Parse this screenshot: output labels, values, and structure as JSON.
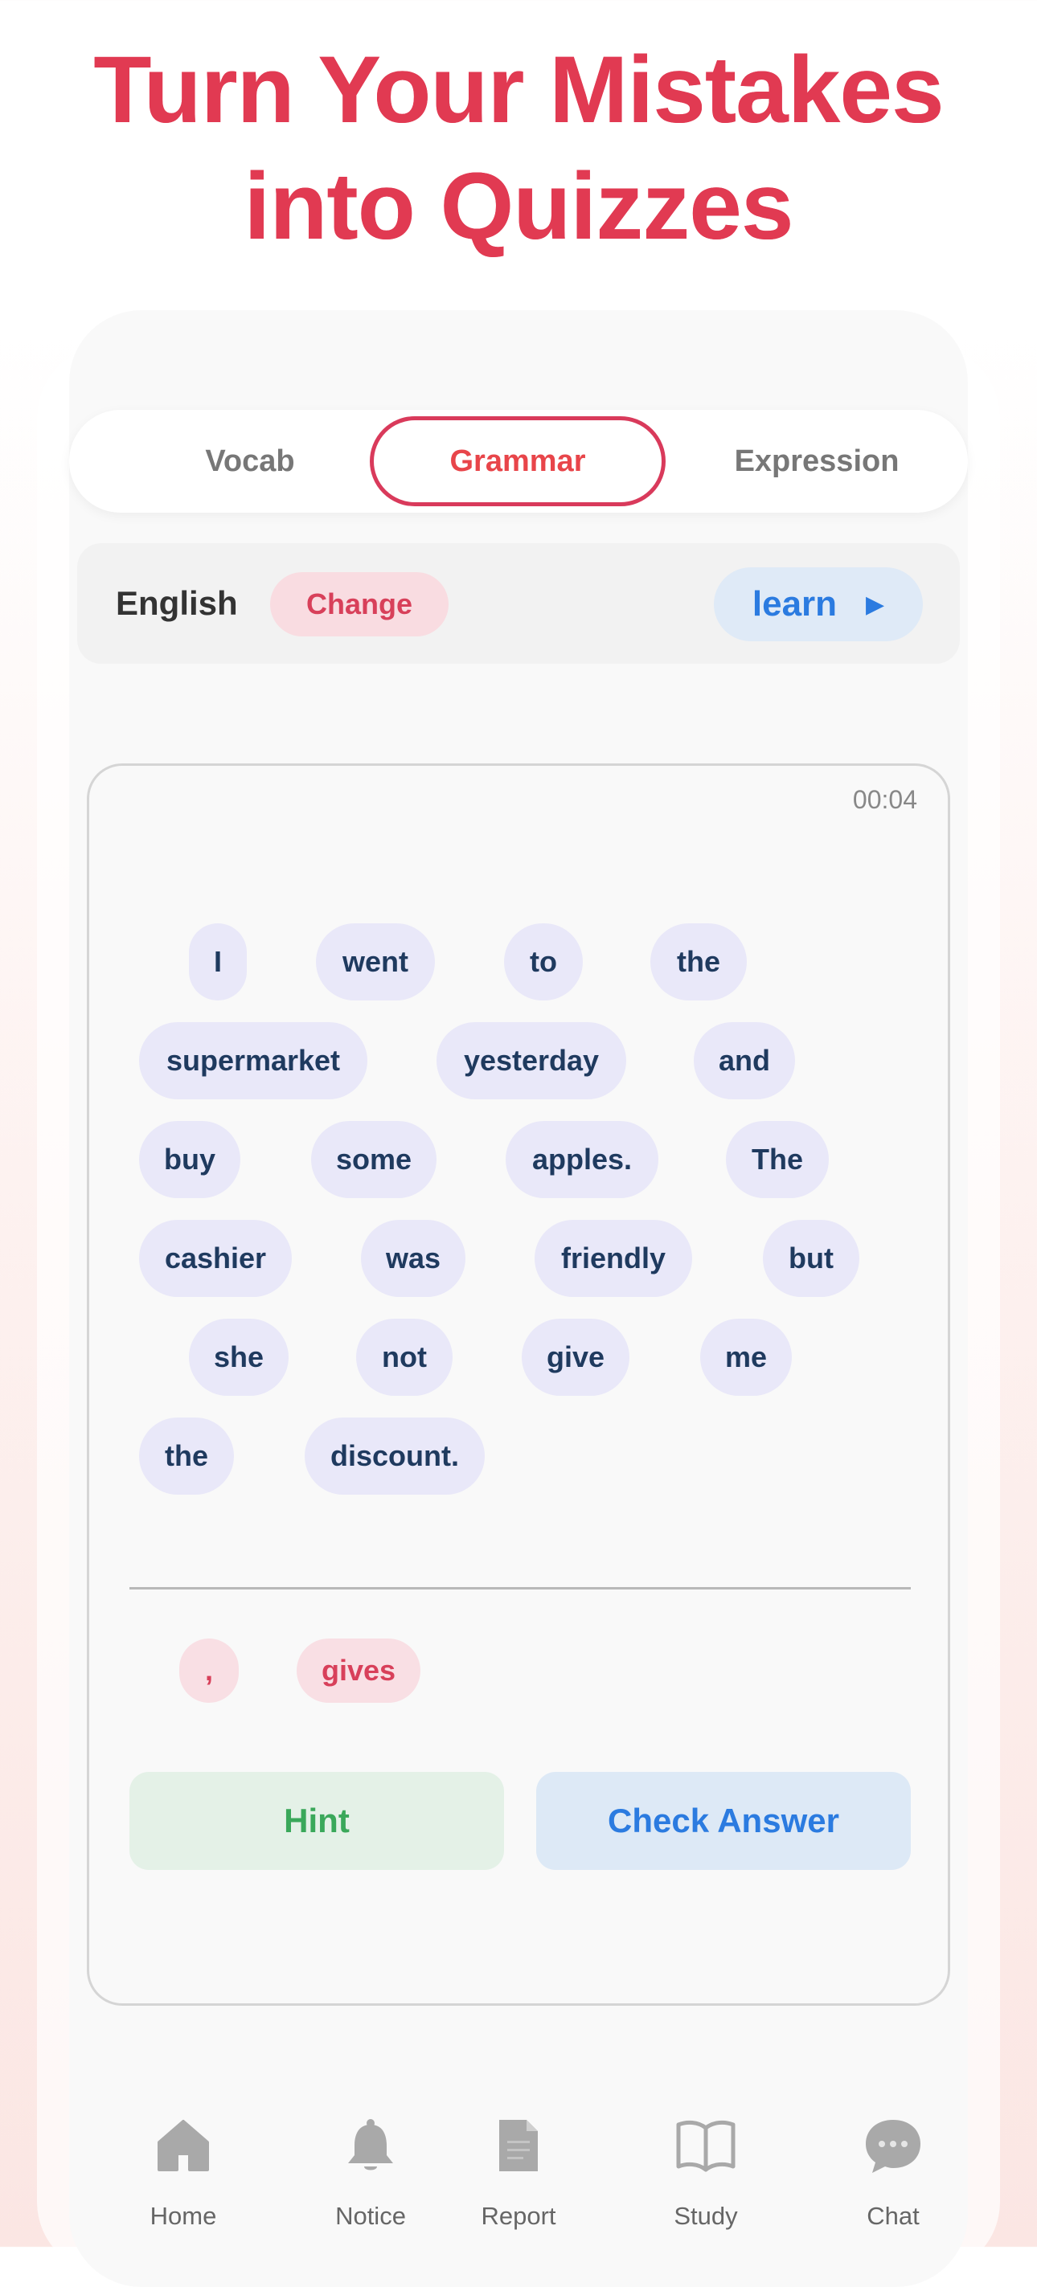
{
  "headline": {
    "line1": "Turn Your Mistakes",
    "line2": "into Quizzes"
  },
  "tabs": [
    {
      "label": "Vocab",
      "active": false
    },
    {
      "label": "Grammar",
      "active": true
    },
    {
      "label": "Expression",
      "active": false
    }
  ],
  "language_bar": {
    "language": "English",
    "change_label": "Change",
    "learn_label": "learn",
    "learn_icon": "play-triangle-icon"
  },
  "quiz": {
    "timer": "00:04",
    "words": [
      "I",
      "went",
      "to",
      "the",
      "supermarket",
      "yesterday",
      "and",
      "buy",
      "some",
      "apples.",
      "The",
      "cashier",
      "was",
      "friendly",
      "but",
      "she",
      "not",
      "give",
      "me",
      "the",
      "discount."
    ],
    "extra_words": [
      ",",
      "gives"
    ],
    "hint_label": "Hint",
    "check_label": "Check Answer"
  },
  "nav": [
    {
      "label": "Home",
      "icon": "home-icon"
    },
    {
      "label": "Notice",
      "icon": "bell-icon"
    },
    {
      "label": "Report",
      "icon": "document-icon"
    },
    {
      "label": "Study",
      "icon": "book-icon"
    },
    {
      "label": "Chat",
      "icon": "chat-bubble-icon"
    }
  ],
  "colors": {
    "accent_red": "#e13a52",
    "accent_blue": "#2b7be0",
    "hint_green": "#3aa85a",
    "chip_bg": "#e9e8f9",
    "chip_text": "#1f3a5f"
  }
}
